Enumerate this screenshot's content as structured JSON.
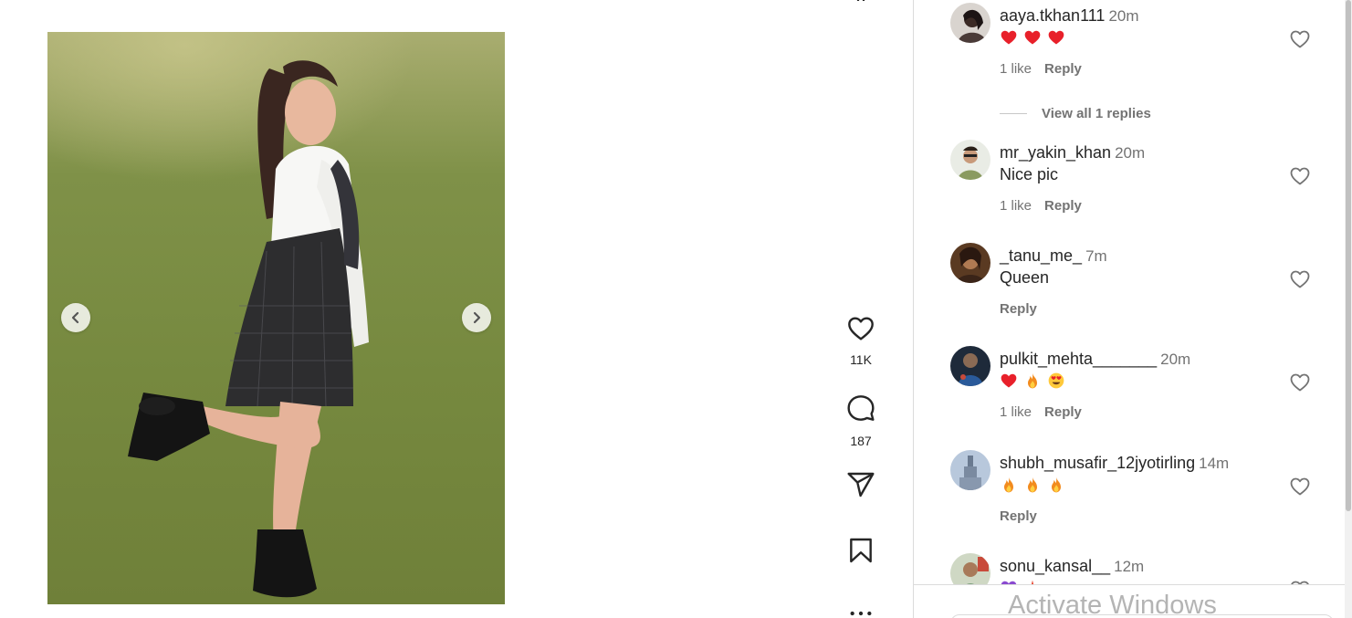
{
  "post": {
    "nav_prev_icon": "chevron-left-icon",
    "nav_next_icon": "chevron-right-icon"
  },
  "actions": {
    "like_icon": "heart-icon",
    "like_count": "11K",
    "comment_icon": "comment-icon",
    "comment_count": "187",
    "share_icon": "paper-plane-icon",
    "save_icon": "bookmark-icon",
    "more_icon": "more-horizontal-icon"
  },
  "comments": [
    {
      "username": "aaya.tkhan111",
      "time": "20m",
      "emojis": [
        "red-heart",
        "red-heart",
        "red-heart"
      ],
      "likes": "1 like",
      "reply": "Reply",
      "view_replies": "View all 1 replies"
    },
    {
      "username": "mr_yakin_khan",
      "time": "20m",
      "text": "Nice pic",
      "likes": "1 like",
      "reply": "Reply"
    },
    {
      "username": "_tanu_me_",
      "time": "7m",
      "text": "Queen",
      "reply": "Reply"
    },
    {
      "username": "pulkit_mehta_______",
      "time": "20m",
      "emojis": [
        "red-heart",
        "fire",
        "heart-eyes"
      ],
      "likes": "1 like",
      "reply": "Reply"
    },
    {
      "username": "shubh_musafir_12jyotirling",
      "time": "14m",
      "emojis": [
        "fire",
        "fire",
        "fire"
      ],
      "reply": "Reply"
    },
    {
      "username": "sonu_kansal__",
      "time": "12m"
    }
  ],
  "overlay": {
    "watermark": "Activate Windows"
  },
  "colors": {
    "text": "#262626",
    "secondary": "#737373",
    "heart_red": "#ed4956",
    "divider": "#dbdbdb"
  }
}
